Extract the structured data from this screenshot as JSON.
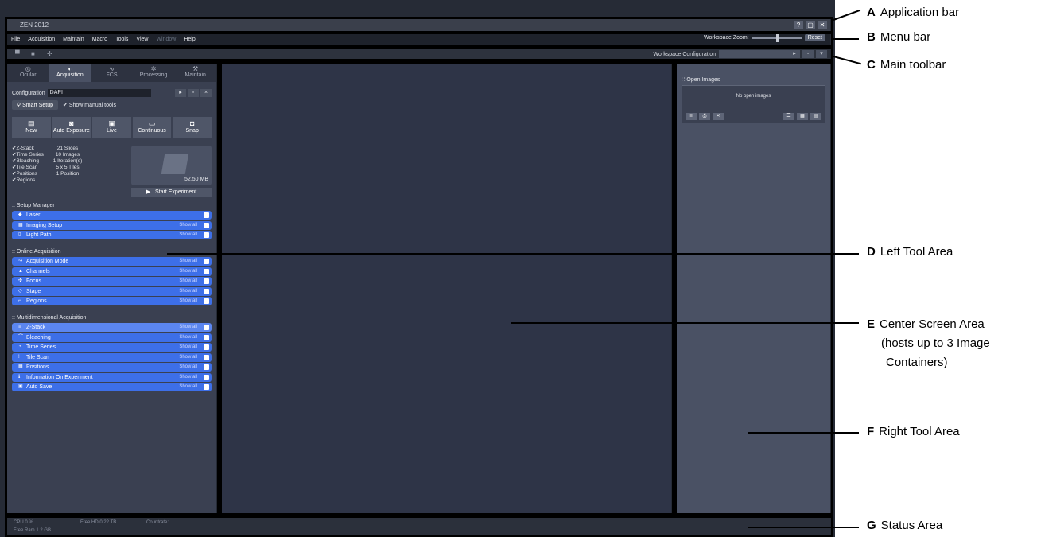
{
  "app_title": "ZEN 2012",
  "window_buttons": [
    "?",
    "▢",
    "✕"
  ],
  "menu": {
    "items": [
      "File",
      "Acquisition",
      "Maintain",
      "Macro",
      "Tools",
      "View",
      "Window",
      "Help"
    ],
    "disabled": "Window",
    "zoom_label": "Workspace Zoom:",
    "reset_label": "Reset"
  },
  "toolbar": {
    "ws_config_label": "Workspace Configuration"
  },
  "left": {
    "tabs": [
      "Ocular",
      "Acquisition",
      "FCS",
      "Processing",
      "Maintain"
    ],
    "active_tab": "Acquisition",
    "config_label": "Configuration",
    "config_value": "DAPI",
    "smart_setup": "Smart Setup",
    "show_manual": "Show manual tools",
    "acq_buttons": [
      "New",
      "Auto Exposure",
      "Live",
      "Continuous",
      "Snap"
    ],
    "experiment": [
      {
        "k": "Z-Stack",
        "v": "21 Slices"
      },
      {
        "k": "Time Series",
        "v": "10 Images"
      },
      {
        "k": "Bleaching",
        "v": "1 Iteration(s)"
      },
      {
        "k": "Tile Scan",
        "v": "5 x 5 Tiles"
      },
      {
        "k": "Positions",
        "v": "1 Position"
      },
      {
        "k": "Regions",
        "v": ""
      }
    ],
    "exp_size": "52.50 MB",
    "start_experiment": "Start Experiment",
    "sections": [
      {
        "title": "Setup Manager",
        "tools": [
          "Laser",
          "Imaging Setup",
          "Light Path"
        ]
      },
      {
        "title": "Online Acquisition",
        "tools": [
          "Acquisition Mode",
          "Channels",
          "Focus",
          "Stage",
          "Regions"
        ]
      },
      {
        "title": "Multidimensional Acquisition",
        "tools": [
          "Z-Stack",
          "Bleaching",
          "Time Series",
          "Tile Scan",
          "Positions",
          "Information On Experiment",
          "Auto Save"
        ]
      }
    ],
    "show_all": "Show all"
  },
  "right": {
    "open_images": "Open Images",
    "no_images": "No open images"
  },
  "status": {
    "cpu": "CPU      0 %",
    "free_hd": "Free HD    0.22 TB",
    "countrate": "Countrate:",
    "free_ram": "Free Ram   1.2 GB"
  },
  "callouts": [
    {
      "letter": "A",
      "text": "Application bar"
    },
    {
      "letter": "B",
      "text": "Menu bar"
    },
    {
      "letter": "C",
      "text": "Main toolbar"
    },
    {
      "letter": "D",
      "text": "Left Tool Area"
    },
    {
      "letter": "E",
      "text": "Center Screen Area",
      "text2": "(hosts up to 3 Image",
      "text3": "Containers)"
    },
    {
      "letter": "F",
      "text": "Right Tool Area"
    },
    {
      "letter": "G",
      "text": "Status Area"
    }
  ]
}
